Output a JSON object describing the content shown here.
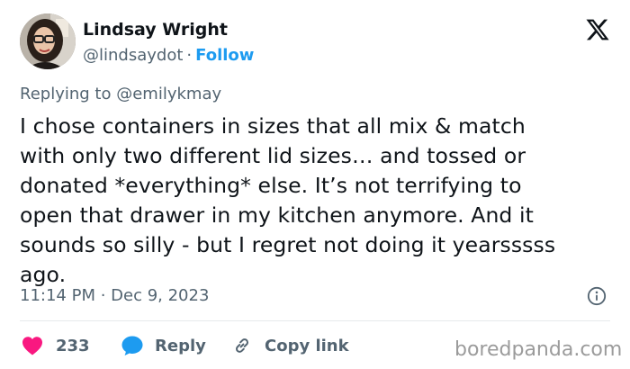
{
  "author": {
    "name": "Lindsay Wright",
    "handle": "@lindsaydot",
    "separator": "·",
    "follow_label": "Follow"
  },
  "reply_context": {
    "prefix": "Replying to",
    "handle": "@emilykmay"
  },
  "tweet": {
    "lines": [
      "I chose containers in sizes that all mix & match",
      "with only two different lid sizes… and tossed or",
      "donated *everything* else. It’s not terrifying to",
      "open that drawer in my kitchen anymore. And it",
      "sounds so silly - but I regret not doing it yearsssss",
      "ago."
    ],
    "timestamp": "11:14 PM · Dec 9, 2023"
  },
  "actions": {
    "likes": "233",
    "reply_label": "Reply",
    "copy_link_label": "Copy link"
  },
  "watermark": "boredpanda.com",
  "colors": {
    "accent": "#1d9bf0",
    "heart": "#f91880",
    "muted": "#536471",
    "text": "#0f1419"
  },
  "icons": {
    "logo": "x-logo-icon",
    "info": "info-icon",
    "like": "heart-icon",
    "reply": "reply-bubble-icon",
    "copy": "link-icon"
  }
}
